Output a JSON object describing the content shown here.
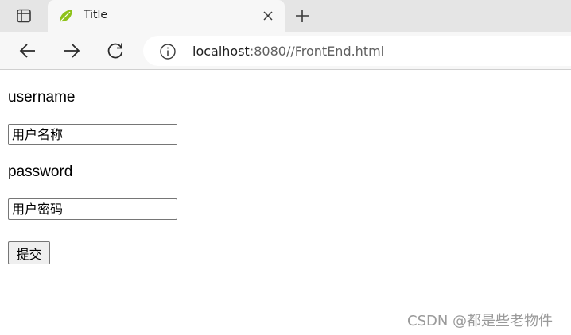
{
  "browser": {
    "tab": {
      "title": "Title",
      "favicon": "spring-leaf-icon"
    },
    "address_bar": {
      "host": "localhost",
      "rest": ":8080//FrontEnd.html"
    },
    "icons": {
      "tab_actions": "tab-actions-icon",
      "close": "close-icon",
      "new_tab": "plus-icon",
      "back": "arrow-left-icon",
      "forward": "arrow-right-icon",
      "reload": "reload-icon",
      "site_info": "info-icon"
    }
  },
  "form": {
    "username_label": "username",
    "username_placeholder": "用户名称",
    "password_label": "password",
    "password_placeholder": "用户密码",
    "submit_label": "提交"
  },
  "watermark": "CSDN @都是些老物件",
  "colors": {
    "tabstrip": "#e5e5e5",
    "toolbar": "#f7f7f7",
    "favicon": "#8ec21a"
  }
}
